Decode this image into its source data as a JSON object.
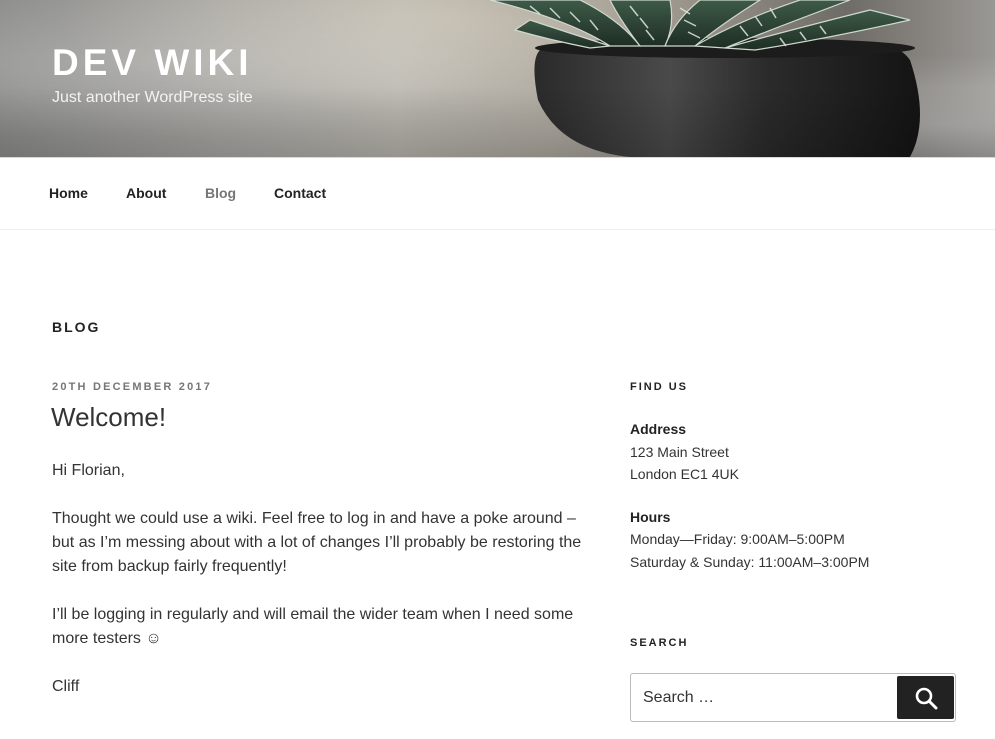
{
  "site": {
    "title": "DEV WIKI",
    "description": "Just another WordPress site"
  },
  "nav": {
    "items": [
      {
        "label": "Home"
      },
      {
        "label": "About"
      },
      {
        "label": "Blog",
        "current": true
      },
      {
        "label": "Contact"
      }
    ]
  },
  "page": {
    "heading": "BLOG"
  },
  "post": {
    "date": "20TH DECEMBER 2017",
    "title": "Welcome!",
    "paragraphs": [
      "Hi Florian,",
      "Thought we could use a wiki.  Feel free to log in and have a poke around – but as I’m messing about with a lot of changes I’ll probably be restoring the site from backup fairly frequently!",
      "I’ll be logging in regularly and will email the wider team when I need some more testers ☺",
      "Cliff"
    ]
  },
  "sidebar": {
    "find_us": {
      "title": "FIND US",
      "address_label": "Address",
      "address_line1": "123 Main Street",
      "address_line2": "London EC1 4UK",
      "hours_label": "Hours",
      "hours_line1": "Monday—Friday: 9:00AM–5:00PM",
      "hours_line2": "Saturday & Sunday: 11:00AM–3:00PM"
    },
    "search": {
      "title": "SEARCH",
      "placeholder": "Search …",
      "icon": "search-icon"
    }
  },
  "colors": {
    "accent_text": "#222222",
    "muted": "#767676",
    "button_bg": "#222222"
  }
}
